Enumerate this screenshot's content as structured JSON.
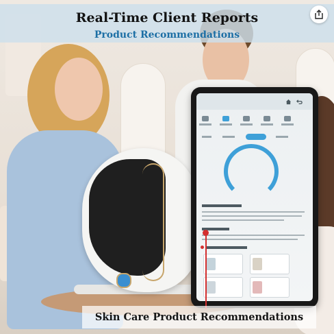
{
  "banner": {
    "title": "Real-Time Client Reports",
    "subtitle": "Product Recommendations"
  },
  "caption": {
    "text": "Skin Care Product Recommendations"
  },
  "icons": {
    "share": "share-icon",
    "home": "home-icon",
    "back": "back-icon"
  },
  "colors": {
    "banner_background": "#cddfec",
    "subtitle": "#1d6fa5",
    "pointer_line": "#d32f2f",
    "gauge": "#3ea0d8",
    "device_trim": "#c7a56b"
  }
}
